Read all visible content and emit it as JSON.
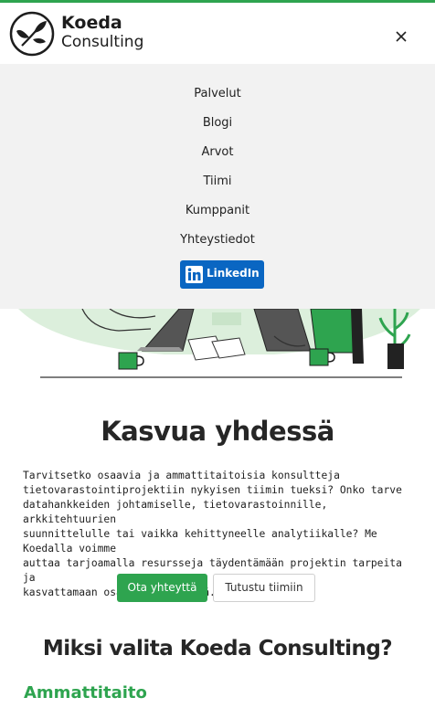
{
  "brand": {
    "name_line1": "Koeda",
    "name_line2": "Consulting",
    "accent_color": "#2ea44f",
    "linkedin_color": "#0a66c2"
  },
  "header": {
    "close_icon": "close-icon"
  },
  "menu": {
    "items": [
      {
        "label": "Palvelut"
      },
      {
        "label": "Blogi"
      },
      {
        "label": "Arvot"
      },
      {
        "label": "Tiimi"
      },
      {
        "label": "Kumppanit"
      },
      {
        "label": "Yhteystiedot"
      }
    ],
    "linkedin": {
      "label": "LinkedIn",
      "icon": "linkedin-icon"
    }
  },
  "hero": {
    "title": "Kasvua yhdessä",
    "text": "Tarvitsetko osaavia ja ammattitaitoisia konsultteja\ntietovarastointiprojektiin nykyisen tiimin tueksi? Onko tarve\ndatahankkeiden johtamiselle, tietovarastoinnille, arkkitehtuurien\nsuunnittelulle tai vaikka kehittyneelle analytiikalle? Me Koedalla voimme\nauttaa tarjoamalla resursseja täydentämään projektin tarpeita ja\nkasvattamaan osaamista yhdessä.",
    "primary_button": "Ota yhteyttä",
    "secondary_button": "Tutustu tiimiin"
  },
  "why": {
    "title": "Miksi valita Koeda Consulting?",
    "first_item": "Ammattitaito"
  }
}
